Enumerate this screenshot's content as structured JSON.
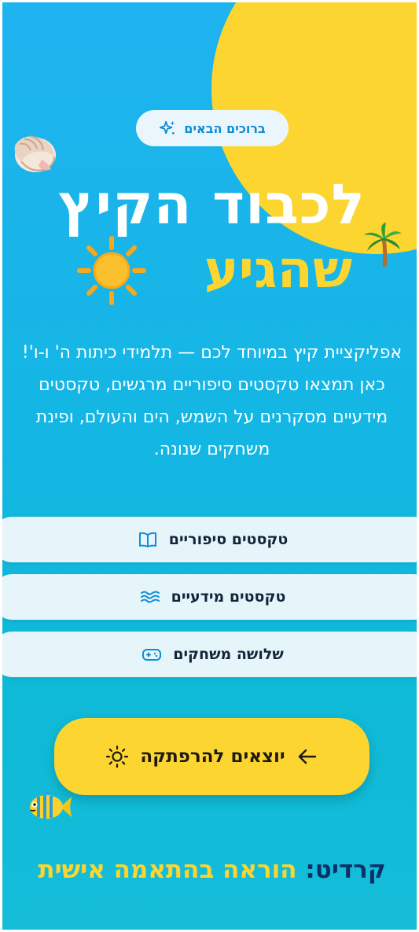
{
  "badge": {
    "label": "ברוכים הבאים",
    "icon": "sparkles-icon"
  },
  "hero": {
    "title_line1": "לכבוד הקיץ",
    "title_line2": "שהגיע",
    "sun_emoji": "sun-icon"
  },
  "intro": {
    "text": "אפליקציית קיץ במיוחד לכם — תלמידי כיתות ה' ו-ו'!\nכאן תמצאו טקסטים סיפוריים מרגשים, טקסטים\nמידעיים מסקרנים על השמש, הים והעולם, ופינת\nמשחקים שנונה."
  },
  "menu": [
    {
      "label": "טקסטים סיפוריים",
      "icon": "open-book-icon"
    },
    {
      "label": "טקסטים מידעיים",
      "icon": "waves-icon"
    },
    {
      "label": "שלושה משחקים",
      "icon": "gamepad-icon"
    }
  ],
  "cta": {
    "label": "יוצאים להרפתקה",
    "icon": "sun-outline-icon",
    "arrow": "arrow-left-icon"
  },
  "credit": {
    "prefix": "קרדיט:",
    "text": "הוראה בהתאמה אישית"
  },
  "decorations": [
    "seashell-icon",
    "palm-tree-icon",
    "fish-icon"
  ],
  "colors": {
    "background_top": "#1fb3ef",
    "background_bottom": "#14bcd8",
    "sun_yellow": "#fdd530",
    "badge_text": "#0c8dd6",
    "credit_prefix": "#0c3168",
    "button_bg": "#e6f5f9"
  }
}
